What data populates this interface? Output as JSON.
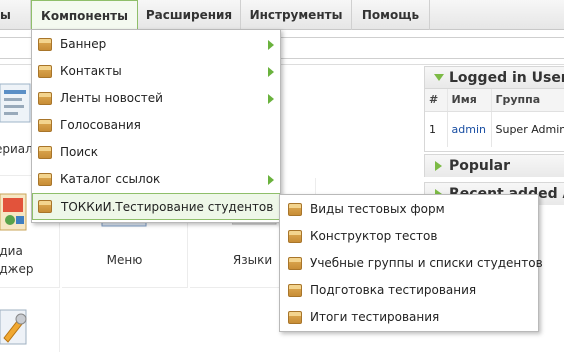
{
  "menubar": {
    "items": [
      {
        "label": "ы"
      },
      {
        "label": "Компоненты"
      },
      {
        "label": "Расширения"
      },
      {
        "label": "Инструменты"
      },
      {
        "label": "Помощь"
      }
    ]
  },
  "dropdown": {
    "items": [
      {
        "label": "Баннер"
      },
      {
        "label": "Контакты"
      },
      {
        "label": "Ленты новостей"
      },
      {
        "label": "Голосования"
      },
      {
        "label": "Поиск"
      },
      {
        "label": "Каталог ссылок"
      },
      {
        "label": "ТОККиИ.Тестирование студентов"
      }
    ]
  },
  "submenu": {
    "items": [
      {
        "label": "Виды тестовых форм"
      },
      {
        "label": "Конструктор тестов"
      },
      {
        "label": "Учебные группы и списки студентов"
      },
      {
        "label": "Подготовка тестирования"
      },
      {
        "label": "Итоги тестирования"
      }
    ]
  },
  "cpanel": {
    "tile_categories": "териал",
    "tile_media_1": "едиа",
    "tile_media_2": "еджер",
    "tile_menu": "Меню",
    "tile_languages": "Языки"
  },
  "logged_users": {
    "title": "Logged in Users",
    "headers": [
      "#",
      "Имя",
      "Группа"
    ],
    "rows": [
      {
        "num": "1",
        "name": "admin",
        "group": "Super Admin"
      }
    ]
  },
  "popular": {
    "title": "Popular"
  },
  "recent": {
    "title": "Recent added Ar"
  },
  "colors": {
    "accent": "#7cba45",
    "link": "#1a4fa3"
  }
}
